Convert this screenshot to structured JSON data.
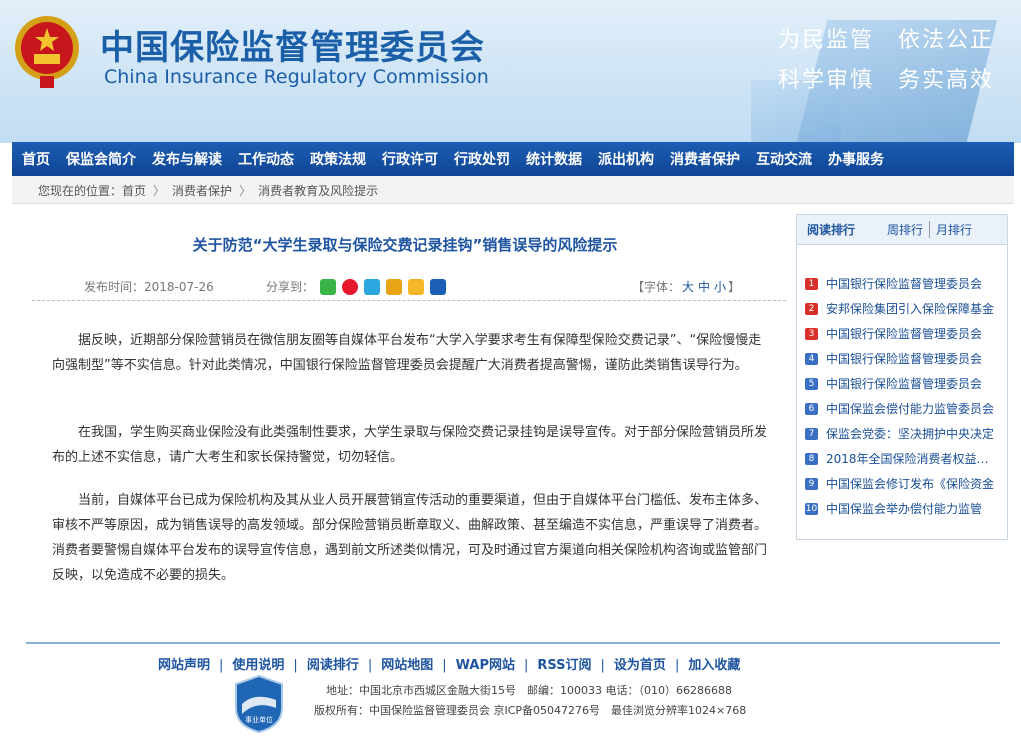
{
  "header": {
    "title_cn": "中国保险监督管理委员会",
    "title_en": "China Insurance Regulatory Commission",
    "slogan_line1": "为民监管　依法公正",
    "slogan_line2": "科学审慎　务实高效"
  },
  "nav": {
    "items": [
      "首页",
      "保监会简介",
      "发布与解读",
      "工作动态",
      "政策法规",
      "行政许可",
      "行政处罚",
      "统计数据",
      "派出机构",
      "消费者保护",
      "互动交流",
      "办事服务"
    ]
  },
  "breadcrumb": {
    "prefix": "您现在的位置：",
    "items": [
      "首页",
      "消费者保护",
      "消费者教育及风险提示"
    ],
    "separator": "〉"
  },
  "article": {
    "title": "关于防范“大学生录取与保险交费记录挂钩”销售误导的风险提示",
    "date_label": "发布时间：",
    "date": "2018-07-26",
    "share_label": "分享到：",
    "fontsize_prefix": "【字体：",
    "fontsize_options": [
      "大",
      "中",
      "小"
    ],
    "fontsize_suffix": "】",
    "paragraphs": [
      "据反映，近期部分保险营销员在微信朋友圈等自媒体平台发布“大学入学要求考生有保障型保险交费记录”、“保险慢慢走向强制型”等不实信息。针对此类情况，中国银行保险监督管理委员会提醒广大消费者提高警惕，谨防此类销售误导行为。",
      "在我国，学生购买商业保险没有此类强制性要求，大学生录取与保险交费记录挂钩是误导宣传。对于部分保险营销员所发布的上述不实信息，请广大考生和家长保持警觉，切勿轻信。",
      "当前，自媒体平台已成为保险机构及其从业人员开展营销宣传活动的重要渠道，但由于自媒体平台门槛低、发布主体多、审核不严等原因，成为销售误导的高发领域。部分保险营销员断章取义、曲解政策、甚至编造不实信息，严重误导了消费者。消费者要警惕自媒体平台发布的误导宣传信息，遇到前文所述类似情况，可及时通过官方渠道向相关保险机构咨询或监管部门反映，以免造成不必要的损失。"
    ]
  },
  "ranking": {
    "tabs": [
      "阅读排行",
      "周排行",
      "月排行"
    ],
    "items": [
      {
        "num": "1",
        "title": "中国银行保险监督管理委员会",
        "color": "#d9302b"
      },
      {
        "num": "2",
        "title": "安邦保险集团引入保险保障基金",
        "color": "#d9302b"
      },
      {
        "num": "3",
        "title": "中国银行保险监督管理委员会",
        "color": "#d9302b"
      },
      {
        "num": "4",
        "title": "中国银行保险监督管理委员会",
        "color": "#3a6fc4"
      },
      {
        "num": "5",
        "title": "中国银行保险监督管理委员会",
        "color": "#3a6fc4"
      },
      {
        "num": "6",
        "title": "中国保监会偿付能力监管委员会",
        "color": "#3a6fc4"
      },
      {
        "num": "7",
        "title": "保监会党委：坚决拥护中央决定",
        "color": "#3a6fc4"
      },
      {
        "num": "8",
        "title": "2018年全国保险消费者权益保护",
        "color": "#3a6fc4"
      },
      {
        "num": "9",
        "title": "中国保监会修订发布《保险资金",
        "color": "#3a6fc4"
      },
      {
        "num": "10",
        "title": "中国保监会举办偿付能力监管",
        "color": "#3a6fc4"
      }
    ]
  },
  "footer": {
    "links": [
      "网站声明",
      "使用说明",
      "阅读排行",
      "网站地图",
      "WAP网站",
      "RSS订阅",
      "设为首页",
      "加入收藏"
    ],
    "badge_label": "事业单位",
    "address": "地址：中国北京市西城区金融大街15号　邮编：100033 电话：（010）66286688",
    "copyright": "版权所有：中国保险监督管理委员会 京ICP备05047276号　最佳浏览分辨率1024×768"
  },
  "colors": {
    "nav_bg": "#1552a4",
    "link": "#1f55a0",
    "rank_hot": "#d9302b",
    "rank_normal": "#3a6fc4"
  },
  "share_icons": [
    "wechat-icon",
    "weibo-icon",
    "tencent-weibo-icon",
    "douban-icon",
    "qzone-icon",
    "renren-icon"
  ]
}
